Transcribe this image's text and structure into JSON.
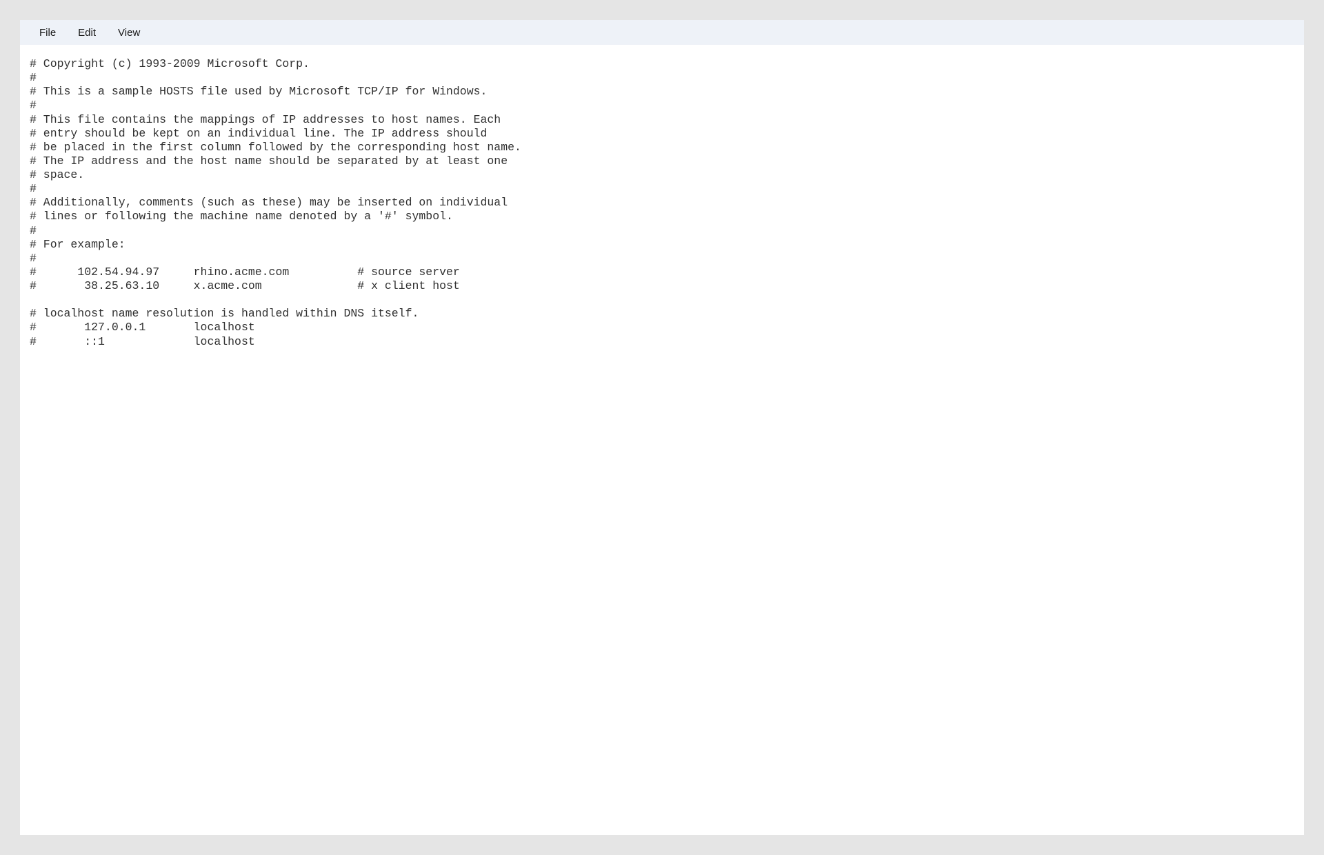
{
  "menubar": {
    "file": "File",
    "edit": "Edit",
    "view": "View"
  },
  "editor": {
    "text": "# Copyright (c) 1993-2009 Microsoft Corp.\n#\n# This is a sample HOSTS file used by Microsoft TCP/IP for Windows.\n#\n# This file contains the mappings of IP addresses to host names. Each\n# entry should be kept on an individual line. The IP address should\n# be placed in the first column followed by the corresponding host name.\n# The IP address and the host name should be separated by at least one\n# space.\n#\n# Additionally, comments (such as these) may be inserted on individual\n# lines or following the machine name denoted by a '#' symbol.\n#\n# For example:\n#\n#      102.54.94.97     rhino.acme.com          # source server\n#       38.25.63.10     x.acme.com              # x client host\n\n# localhost name resolution is handled within DNS itself.\n#       127.0.0.1       localhost\n#       ::1             localhost"
  }
}
